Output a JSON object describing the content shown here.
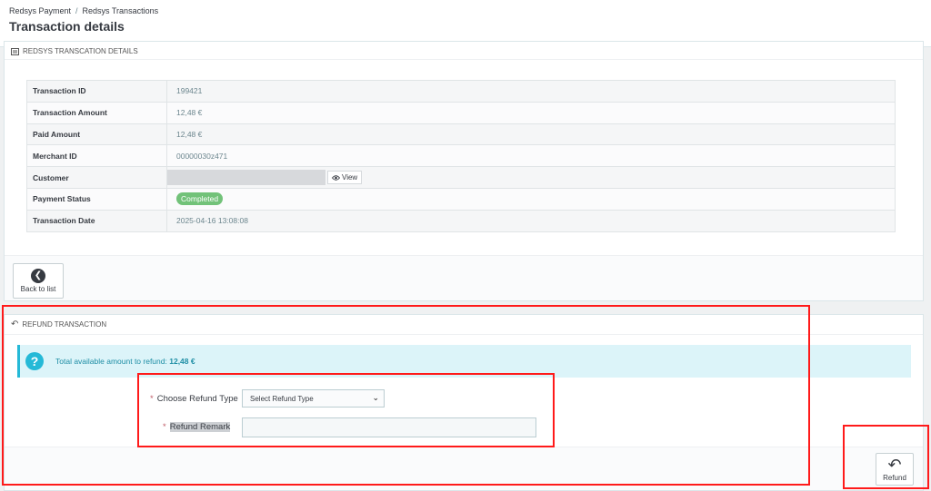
{
  "breadcrumb": {
    "first": "Redsys Payment",
    "separator": "/",
    "second": "Redsys Transactions"
  },
  "page_title": "Transaction details",
  "details_panel": {
    "heading": "REDSYS TRANSCATION DETAILS",
    "rows": [
      {
        "label": "Transaction ID",
        "value": "199421"
      },
      {
        "label": "Transaction Amount",
        "value": "12,48 €"
      },
      {
        "label": "Paid Amount",
        "value": "12,48 €"
      },
      {
        "label": "Merchant ID",
        "value": "00000030z471"
      },
      {
        "label": "Customer",
        "view_label": "View"
      },
      {
        "label": "Payment Status",
        "value": "Completed"
      },
      {
        "label": "Transaction Date",
        "value": "2025-04-16 13:08:08"
      }
    ],
    "back_label": "Back to list"
  },
  "refund_panel": {
    "heading": "REFUND TRANSACTION",
    "alert_text": "Total available amount to refund:",
    "alert_amount": "12,48 €",
    "refund_type_label": "Choose Refund Type",
    "refund_type_selected": "Select Refund Type",
    "remark_label": "Refund Remark",
    "remark_value": "",
    "required_mark": "*",
    "refund_button": "Refund"
  },
  "colors": {
    "status_badge": "#72c279",
    "info_accent": "#25b9d7",
    "annotation": "#ff1a1a"
  },
  "icons": [
    "list-icon",
    "arrow-left-circle-icon",
    "reply-icon",
    "question-circle-icon",
    "eye-icon",
    "chevron-down-icon"
  ]
}
